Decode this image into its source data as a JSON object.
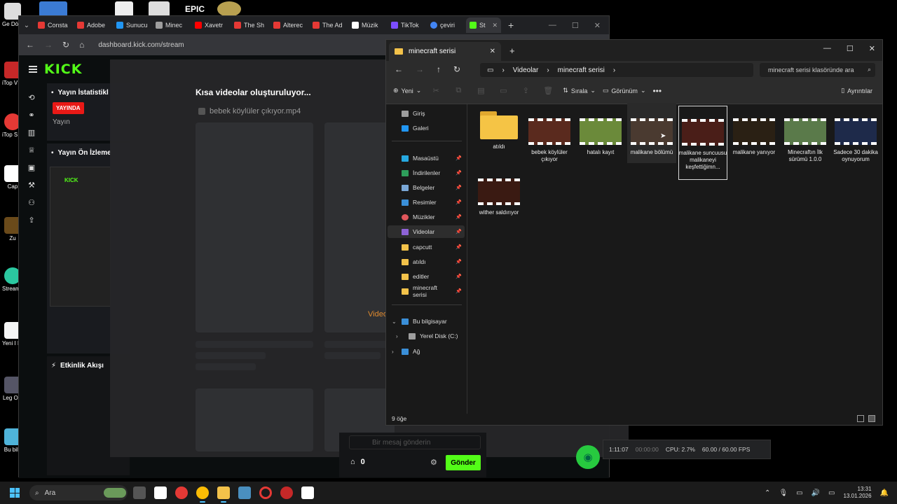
{
  "desktop": {
    "labels": [
      "Ge Dönü",
      "iTop V Edi",
      "iTop S Reco",
      "Cap",
      "Zu",
      "Stream Desk",
      "Yeni I Belge",
      "Leg Onl",
      "Bu bilg"
    ],
    "top_label": "EPIC"
  },
  "browser": {
    "tabs": [
      {
        "label": "Consta",
        "color": "#e53935"
      },
      {
        "label": "Adobe",
        "color": "#e53935"
      },
      {
        "label": "Sunucu",
        "color": "#2196f3"
      },
      {
        "label": "Minec",
        "color": "#9e9e9e"
      },
      {
        "label": "Xavetr",
        "color": "#ff0000"
      },
      {
        "label": "The Sh",
        "color": "#e53935"
      },
      {
        "label": "Alterec",
        "color": "#e53935"
      },
      {
        "label": "The Ad",
        "color": "#e53935"
      },
      {
        "label": "Müzik",
        "color": "#ffffff"
      },
      {
        "label": "TikTok",
        "color": "#7c4dff"
      },
      {
        "label": "çeviri",
        "color": "#4285f4"
      },
      {
        "label": "St",
        "color": "#53fc18"
      }
    ],
    "url": "dashboard.kick.com/stream"
  },
  "kick": {
    "logo": "KICK",
    "stats_title": "Yayın İstatistikl",
    "live_badge": "YAYINDA",
    "yayin_label": "Yayın",
    "preview_title": "Yayın Ön İzleme",
    "activity_title": "Etkinlik Akışı",
    "preview_logo": "KICK",
    "chat_placeholder": "Bir mesaj gönderin",
    "chat_count": "0",
    "send_label": "Gönder"
  },
  "overlay": {
    "title": "Kısa videolar oluşturuluyor...",
    "file": "bebek köylüler çıkıyor.mp4",
    "orange_text": "Videonuz y"
  },
  "obs": {
    "time": "1:11:07",
    "rec_time": "00:00:00",
    "cpu": "CPU: 2.7%",
    "fps": "60.00 / 60.00 FPS"
  },
  "explorer": {
    "tab_title": "minecraft serisi",
    "breadcrumbs": [
      "Videolar",
      "minecraft serisi"
    ],
    "search_placeholder": "minecraft serisi klasöründe ara",
    "cmd": {
      "new": "Yeni",
      "sort": "Sırala",
      "view": "Görünüm",
      "details": "Ayrıntılar"
    },
    "sidebar": [
      {
        "label": "Giriş",
        "color": "#9e9e9e"
      },
      {
        "label": "Galeri",
        "color": "#2196f3"
      },
      {
        "label": "Masaüstü",
        "color": "#26a8e0"
      },
      {
        "label": "İndirilenler",
        "color": "#2e9e5b"
      },
      {
        "label": "Belgeler",
        "color": "#7aa7d6"
      },
      {
        "label": "Resimler",
        "color": "#3a8fd8"
      },
      {
        "label": "Müzikler",
        "color": "#e0565b"
      },
      {
        "label": "Videolar",
        "color": "#8e63d6"
      },
      {
        "label": "capcutt",
        "color": "#f3c24a"
      },
      {
        "label": "atıldı",
        "color": "#f3c24a"
      },
      {
        "label": "editler",
        "color": "#f3c24a"
      },
      {
        "label": "minecraft serisi",
        "color": "#f3c24a"
      },
      {
        "label": "Bu bilgisayar",
        "color": "#3a8fd8"
      },
      {
        "label": "Yerel Disk (C:)",
        "color": "#9e9e9e"
      },
      {
        "label": "Ağ",
        "color": "#3a8fd8"
      }
    ],
    "files": [
      {
        "name": "atıldı",
        "type": "folder"
      },
      {
        "name": "bebek köylüler çıkıyor",
        "color": "#5a2a1e"
      },
      {
        "name": "hatalı kayıt",
        "color": "#6b8a3a"
      },
      {
        "name": "malikane bölümü",
        "color": "#4a3a30"
      },
      {
        "name": "malikane suncuusu malikaneyi keşfettiğimn...",
        "color": "#4a1e18"
      },
      {
        "name": "malikane yanıyor",
        "color": "#2a2014"
      },
      {
        "name": "Minecraftın İlk sürümü 1.0.0",
        "color": "#5a7a4a"
      },
      {
        "name": "Sadece 30 dakika oynuyorum",
        "color": "#1e2a4a"
      },
      {
        "name": "wither saldırıyor",
        "color": "#3a1a12"
      }
    ],
    "status": "9 öğe"
  },
  "taskbar": {
    "search": "Ara",
    "time": "13:31",
    "date": "13.01.2026"
  }
}
